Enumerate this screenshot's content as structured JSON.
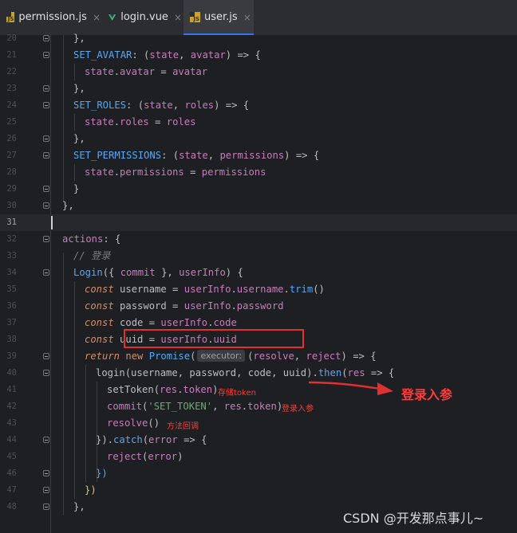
{
  "tabs": [
    {
      "label": "permission.js",
      "icon": "js-file-icon",
      "close": "×"
    },
    {
      "label": "login.vue",
      "icon": "vue-file-icon",
      "close": "×"
    },
    {
      "label": "user.js",
      "icon": "js-file-icon",
      "close": "×",
      "active": true
    }
  ],
  "line_numbers": [
    "20",
    "21",
    "22",
    "23",
    "24",
    "25",
    "26",
    "27",
    "28",
    "29",
    "30",
    "31",
    "32",
    "33",
    "34",
    "35",
    "36",
    "37",
    "38",
    "39",
    "40",
    "41",
    "42",
    "43",
    "44",
    "45",
    "46",
    "47",
    "48"
  ],
  "code": {
    "l20": "},",
    "l21_a": "SET_AVATAR",
    "l21_b": ": (",
    "l21_c": "state",
    "l21_d": ", ",
    "l21_e": "avatar",
    "l21_f": ") => {",
    "l22_a": "state",
    "l22_b": ".",
    "l22_c": "avatar",
    "l22_d": " = ",
    "l22_e": "avatar",
    "l23": "},",
    "l24_a": "SET_ROLES",
    "l24_b": ": (",
    "l24_c": "state",
    "l24_d": ", ",
    "l24_e": "roles",
    "l24_f": ") => {",
    "l25_a": "state",
    "l25_b": ".",
    "l25_c": "roles",
    "l25_d": " = ",
    "l25_e": "roles",
    "l26": "},",
    "l27_a": "SET_PERMISSIONS",
    "l27_b": ": (",
    "l27_c": "state",
    "l27_d": ", ",
    "l27_e": "permissions",
    "l27_f": ") => {",
    "l28_a": "state",
    "l28_b": ".",
    "l28_c": "permissions",
    "l28_d": " = ",
    "l28_e": "permissions",
    "l29": "}",
    "l30": "},",
    "l32_a": "actions",
    "l32_b": ": {",
    "l33": "// 登录",
    "l34_a": "Login",
    "l34_b": "({ ",
    "l34_c": "commit",
    "l34_d": " }, ",
    "l34_e": "userInfo",
    "l34_f": ") {",
    "l35_a": "const",
    "l35_b": " username = ",
    "l35_c": "userInfo",
    "l35_d": ".",
    "l35_e": "username",
    "l35_f": ".",
    "l35_g": "trim",
    "l35_h": "()",
    "l36_a": "const",
    "l36_b": " password = ",
    "l36_c": "userInfo",
    "l36_d": ".",
    "l36_e": "password",
    "l37_a": "const",
    "l37_b": " code = ",
    "l37_c": "userInfo",
    "l37_d": ".",
    "l37_e": "code",
    "l38_a": "const",
    "l38_b": " uuid = ",
    "l38_c": "userInfo",
    "l38_d": ".",
    "l38_e": "uuid",
    "l39_a": "return",
    "l39_b": " ",
    "l39_c": "new",
    "l39_d": " ",
    "l39_e": "Promise",
    "l39_f": "(",
    "l39_hint": "executor:",
    "l39_g": "(",
    "l39_h": "resolve",
    "l39_i": ", ",
    "l39_j": "reject",
    "l39_k": ") => {",
    "l40_a": "login",
    "l40_b": "(username, password, code, uuid)",
    "l40_c": ".",
    "l40_d": "then",
    "l40_e": "(",
    "l40_f": "res",
    "l40_g": " => {",
    "l41_a": "setToken",
    "l41_b": "(",
    "l41_c": "res",
    "l41_d": ".",
    "l41_e": "token",
    "l41_f": ")",
    "l42_a": "commit",
    "l42_b": "(",
    "l42_c": "'SET_TOKEN'",
    "l42_d": ", ",
    "l42_e": "res",
    "l42_f": ".",
    "l42_g": "token",
    "l42_h": ")",
    "l43_a": "resolve",
    "l43_b": "()",
    "l44_a": "}).",
    "l44_b": "catch",
    "l44_c": "(",
    "l44_d": "error",
    "l44_e": " => {",
    "l45_a": "reject",
    "l45_b": "(",
    "l45_c": "error",
    "l45_d": ")",
    "l46": "})",
    "l47": "})",
    "l48": "},"
  },
  "annotations": {
    "store_token": "存储token",
    "login_param_small": "登录入参",
    "method_callback": "方法回调",
    "login_param_big": "登录入参"
  },
  "watermark": "CSDN @开发那点事儿~",
  "colors": {
    "highlight": "#e03030",
    "accent": "#3574f0"
  }
}
